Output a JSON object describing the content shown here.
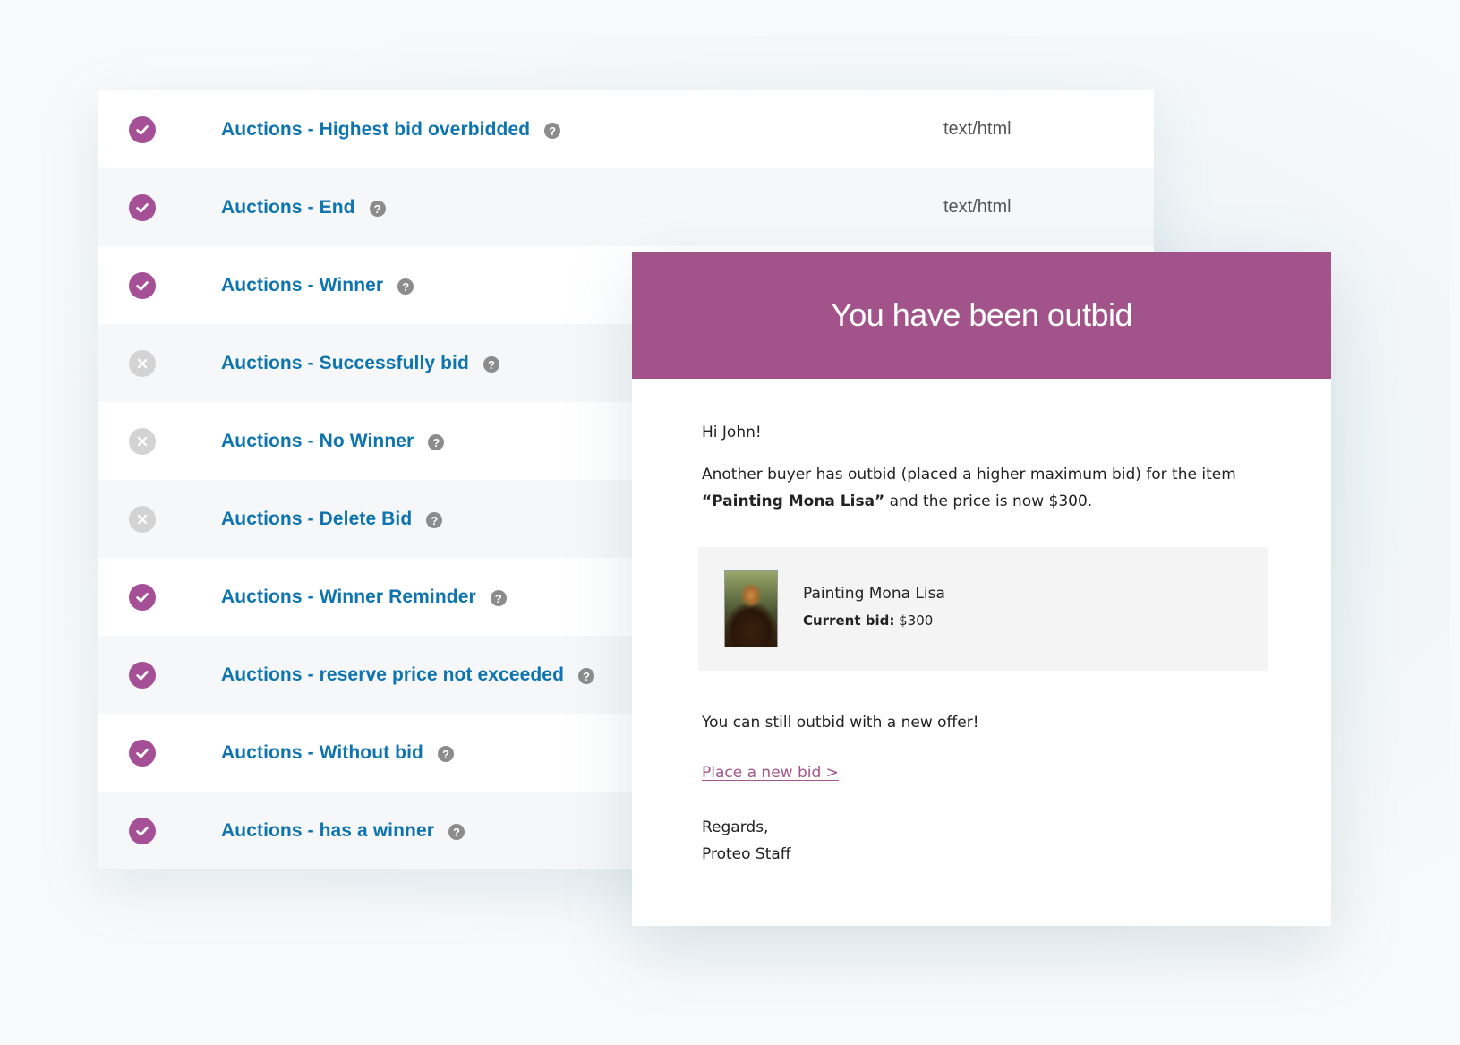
{
  "notifications": {
    "rows": [
      {
        "title": "Auctions - Highest bid overbidded",
        "enabled": true,
        "type": "text/html"
      },
      {
        "title": "Auctions - End",
        "enabled": true,
        "type": "text/html"
      },
      {
        "title": "Auctions - Winner",
        "enabled": true,
        "type": ""
      },
      {
        "title": "Auctions - Successfully bid",
        "enabled": false,
        "type": ""
      },
      {
        "title": "Auctions - No Winner",
        "enabled": false,
        "type": ""
      },
      {
        "title": "Auctions - Delete Bid",
        "enabled": false,
        "type": ""
      },
      {
        "title": "Auctions - Winner Reminder",
        "enabled": true,
        "type": ""
      },
      {
        "title": "Auctions - reserve price not exceeded",
        "enabled": true,
        "type": ""
      },
      {
        "title": "Auctions - Without bid",
        "enabled": true,
        "type": ""
      },
      {
        "title": "Auctions - has a winner",
        "enabled": true,
        "type": ""
      }
    ],
    "help_glyph": "?"
  },
  "email": {
    "title": "You have been outbid",
    "greeting": "Hi John!",
    "intro_before": "Another buyer has outbid (placed a higher maximum bid) for the item ",
    "intro_item": "“Painting Mona Lisa”",
    "intro_after": " and the price is now $300.",
    "product": {
      "name": "Painting Mona Lisa",
      "bid_label": "Current bid:",
      "bid_value": " $300"
    },
    "outbid_text": "You can still outbid with a new offer!",
    "cta_label": "Place a new bid >",
    "regards": "Regards,",
    "signature": "Proteo Staff"
  },
  "colors": {
    "brand_purple": "#a2548a",
    "link_blue": "#0e74b0",
    "disabled_gray": "#d3d3d3"
  }
}
